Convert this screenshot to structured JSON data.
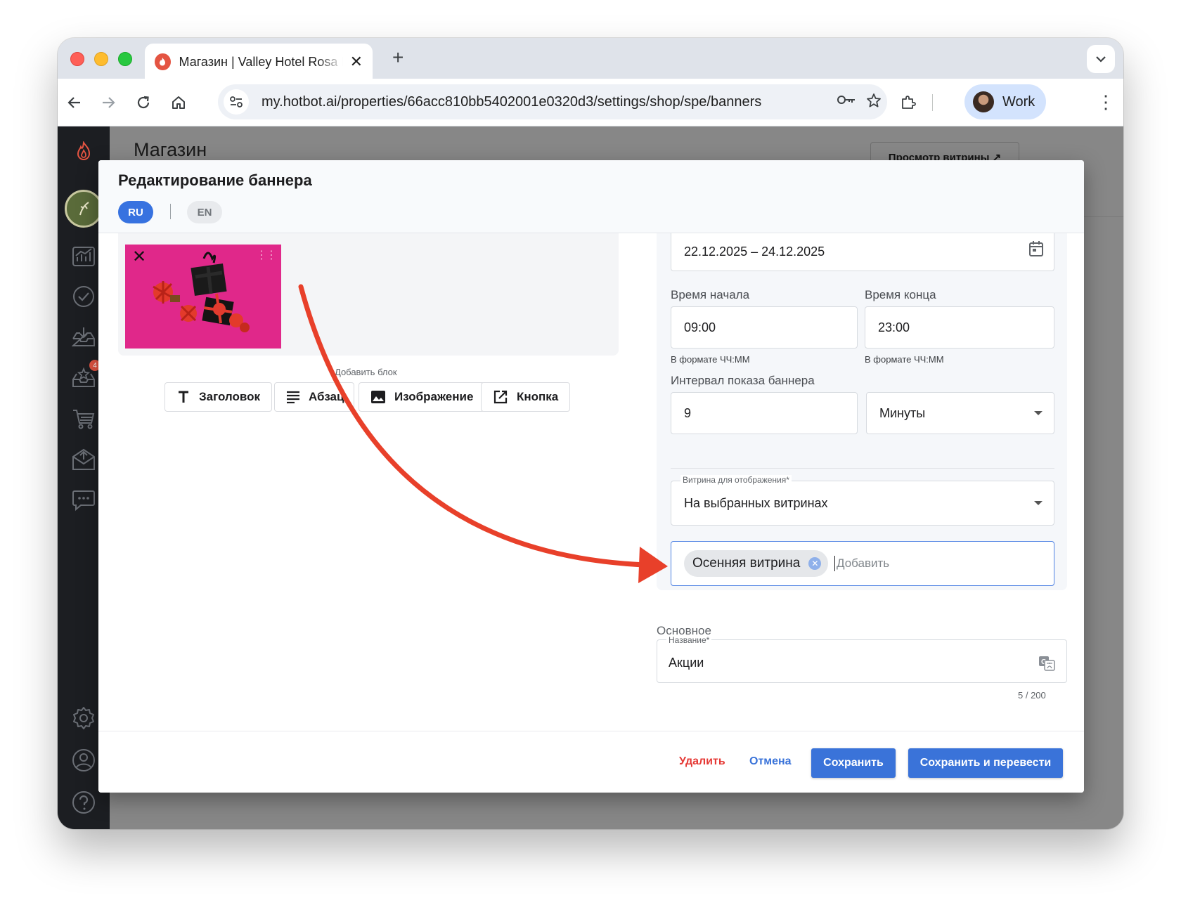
{
  "browser": {
    "tab_title": "Магазин | Valley Hotel Rosa K",
    "tab_favicon": "flame-icon",
    "url": "my.hotbot.ai/properties/66acc810bb5402001e0320d3/settings/shop/spe/banners",
    "profile_name": "Work"
  },
  "page": {
    "title": "Магазин",
    "preview_button": "Просмотр витрины ↗"
  },
  "sidebar": {
    "badge_count": "4",
    "icons": [
      "flame-logo-icon",
      "user-avatar-icon",
      "analytics-icon",
      "tasks-icon",
      "inbox-icon",
      "reviews-icon",
      "cart-icon",
      "mail-icon",
      "chat-icon",
      "settings-icon",
      "profile-icon",
      "help-icon"
    ]
  },
  "modal": {
    "title": "Редактирование баннера",
    "lang_ru": "RU",
    "lang_en": "EN",
    "add_block_label": "Добавить блок",
    "blocks": {
      "heading": "Заголовок",
      "paragraph": "Абзац",
      "image": "Изображение",
      "button": "Кнопка"
    },
    "form": {
      "date_range": "22.12.2025 – 24.12.2025",
      "start_time_label": "Время начала",
      "start_time": "09:00",
      "start_time_hint": "В формате ЧЧ:ММ",
      "end_time_label": "Время конца",
      "end_time": "23:00",
      "end_time_hint": "В формате ЧЧ:ММ",
      "interval_label": "Интервал показа баннера",
      "interval_value": "9",
      "interval_unit": "Минуты",
      "showcase_label": "Витрина для отображения*",
      "showcase_value": "На выбранных витринах",
      "selected_chip": "Осенняя витрина",
      "chip_input_placeholder": "Добавить",
      "section_main": "Основное",
      "name_label": "Название*",
      "name_value": "Акции",
      "name_counter": "5 / 200"
    },
    "footer": {
      "delete": "Удалить",
      "cancel": "Отмена",
      "save": "Сохранить",
      "save_translate": "Сохранить и перевести"
    }
  },
  "colors": {
    "accent": "#3a73d9",
    "danger": "#e53935",
    "annotation_arrow": "#e8402a"
  }
}
